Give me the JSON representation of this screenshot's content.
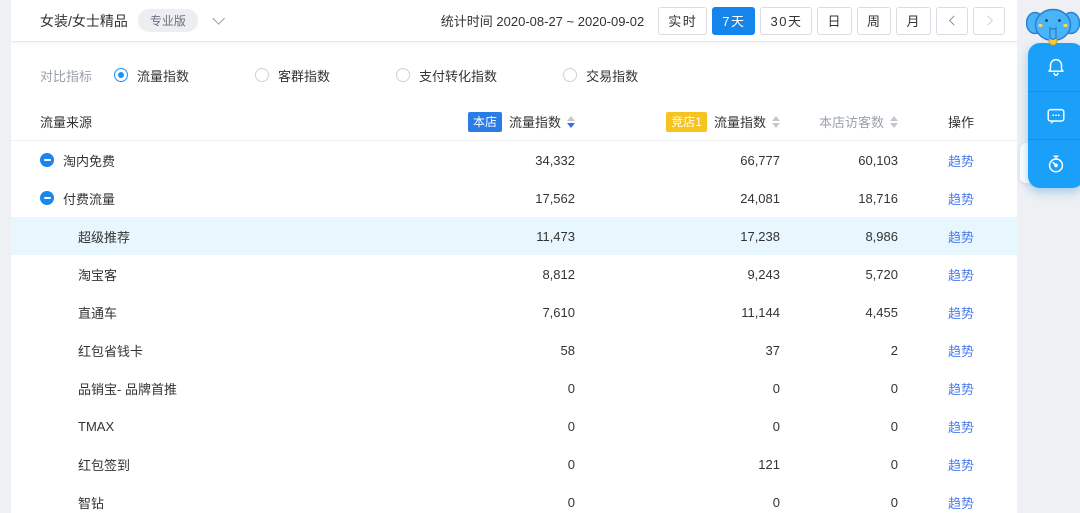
{
  "topbar": {
    "category": "女装/女士精品",
    "badge": "专业版",
    "stat_time": "统计时间 2020-08-27 ~ 2020-09-02",
    "periods": [
      {
        "label": "实时",
        "active": false
      },
      {
        "label": "7天",
        "active": true
      },
      {
        "label": "30天",
        "active": false
      },
      {
        "label": "日",
        "active": false
      },
      {
        "label": "周",
        "active": false
      },
      {
        "label": "月",
        "active": false
      }
    ],
    "pager": {
      "prev_icon": "chevron-left-icon",
      "prev_enabled": true,
      "next_icon": "chevron-right-icon",
      "next_enabled": false
    }
  },
  "metrics": {
    "label": "对比指标",
    "options": [
      {
        "label": "流量指数",
        "selected": true
      },
      {
        "label": "客群指数",
        "selected": false
      },
      {
        "label": "支付转化指数",
        "selected": false
      },
      {
        "label": "交易指数",
        "selected": false
      }
    ]
  },
  "table": {
    "action_label": "趋势",
    "columns": [
      {
        "key": "name",
        "label": "流量来源"
      },
      {
        "key": "shop",
        "label": "流量指数",
        "badge": "本店",
        "badge_style": "blue",
        "sort": "desc"
      },
      {
        "key": "comp",
        "label": "流量指数",
        "badge": "竞店1",
        "badge_style": "yellow",
        "sort": "none"
      },
      {
        "key": "visitors",
        "label": "本店访客数",
        "muted": true,
        "sort": "none"
      },
      {
        "key": "action",
        "label": "操作"
      }
    ],
    "rows": [
      {
        "name": "淘内免费",
        "level": 0,
        "expandable": true,
        "highlighted": false,
        "shop": "34,332",
        "comp": "66,777",
        "visitors": "60,103"
      },
      {
        "name": "付费流量",
        "level": 0,
        "expandable": true,
        "highlighted": false,
        "shop": "17,562",
        "comp": "24,081",
        "visitors": "18,716"
      },
      {
        "name": "超级推荐",
        "level": 1,
        "expandable": false,
        "highlighted": true,
        "shop": "11,473",
        "comp": "17,238",
        "visitors": "8,986"
      },
      {
        "name": "淘宝客",
        "level": 1,
        "expandable": false,
        "highlighted": false,
        "shop": "8,812",
        "comp": "9,243",
        "visitors": "5,720"
      },
      {
        "name": "直通车",
        "level": 1,
        "expandable": false,
        "highlighted": false,
        "shop": "7,610",
        "comp": "11,144",
        "visitors": "4,455"
      },
      {
        "name": "红包省钱卡",
        "level": 1,
        "expandable": false,
        "highlighted": false,
        "shop": "58",
        "comp": "37",
        "visitors": "2"
      },
      {
        "name": "品销宝- 品牌首推",
        "level": 1,
        "expandable": false,
        "highlighted": false,
        "shop": "0",
        "comp": "0",
        "visitors": "0"
      },
      {
        "name": "TMAX",
        "level": 1,
        "expandable": false,
        "highlighted": false,
        "shop": "0",
        "comp": "0",
        "visitors": "0"
      },
      {
        "name": "红包签到",
        "level": 1,
        "expandable": false,
        "highlighted": false,
        "shop": "0",
        "comp": "121",
        "visitors": "0"
      },
      {
        "name": "智钻",
        "level": 1,
        "expandable": false,
        "highlighted": false,
        "shop": "0",
        "comp": "0",
        "visitors": "0"
      }
    ]
  },
  "sidebar": {
    "mascot": "elephant-mascot",
    "icons": [
      "bell-icon",
      "chat-icon",
      "stopwatch-icon"
    ]
  },
  "colors": {
    "accent_blue": "#1585ec",
    "panel_blue": "#1aa0f8",
    "badge_shop": "#2a7de5",
    "badge_competitor": "#f6c320",
    "trend_link": "#4a7cf0",
    "row_highlight": "#e8f6fe",
    "page_bg": "#eef0f4"
  }
}
